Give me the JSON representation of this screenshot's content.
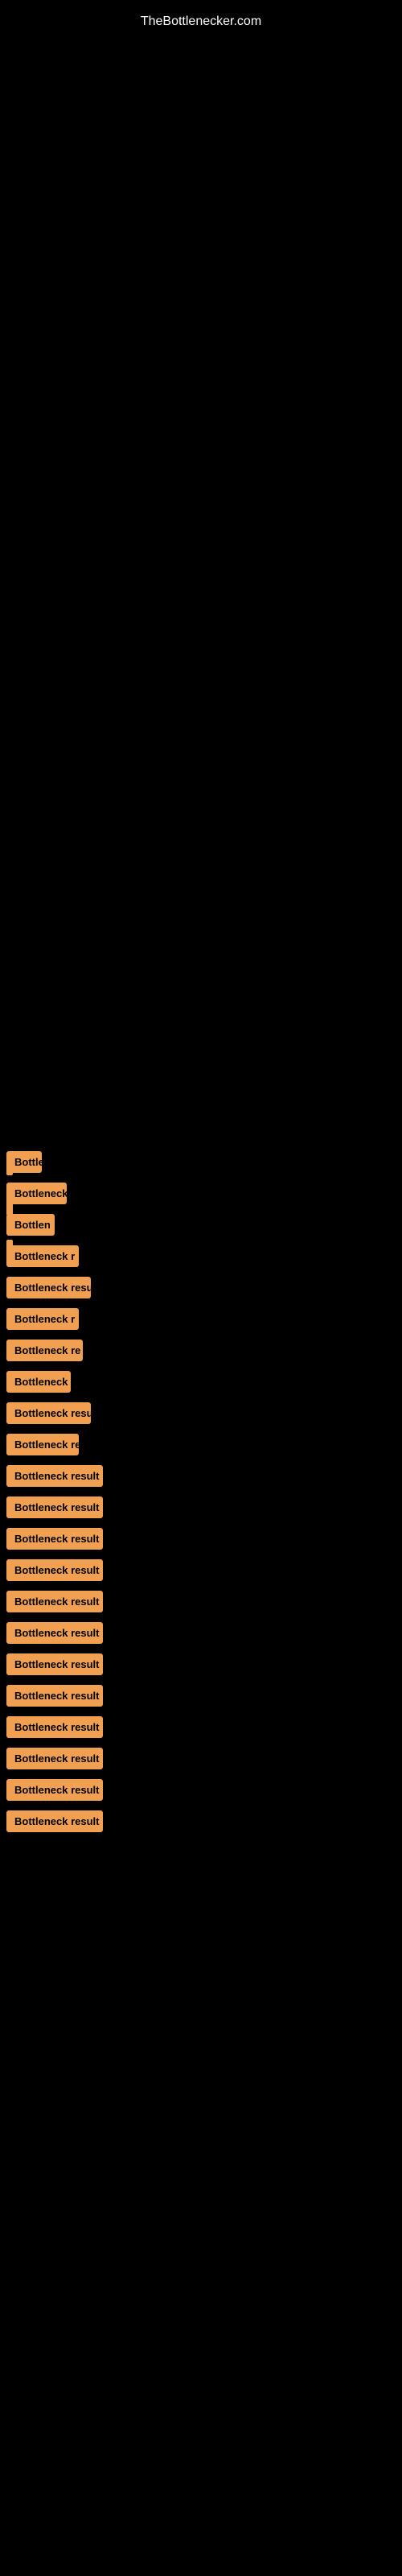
{
  "site": {
    "title": "TheBottlenecker.com"
  },
  "indicators": [
    {
      "id": "ind-1"
    },
    {
      "id": "ind-2"
    },
    {
      "id": "ind-3"
    }
  ],
  "items": [
    {
      "id": 1,
      "label": "Bottle",
      "class": "item-1"
    },
    {
      "id": 2,
      "label": "Bottleneck",
      "class": "item-2"
    },
    {
      "id": 3,
      "label": "Bottlen",
      "class": "item-3"
    },
    {
      "id": 4,
      "label": "Bottleneck r",
      "class": "item-4"
    },
    {
      "id": 5,
      "label": "Bottleneck resu",
      "class": "item-5"
    },
    {
      "id": 6,
      "label": "Bottleneck r",
      "class": "item-6"
    },
    {
      "id": 7,
      "label": "Bottleneck re",
      "class": "item-7"
    },
    {
      "id": 8,
      "label": "Bottleneck",
      "class": "item-8"
    },
    {
      "id": 9,
      "label": "Bottleneck resu",
      "class": "item-9"
    },
    {
      "id": 10,
      "label": "Bottleneck re",
      "class": "item-10"
    },
    {
      "id": 11,
      "label": "Bottleneck result",
      "class": "item-11"
    },
    {
      "id": 12,
      "label": "Bottleneck result",
      "class": "item-12"
    },
    {
      "id": 13,
      "label": "Bottleneck result",
      "class": "item-13"
    },
    {
      "id": 14,
      "label": "Bottleneck result",
      "class": "item-14"
    },
    {
      "id": 15,
      "label": "Bottleneck result",
      "class": "item-15"
    },
    {
      "id": 16,
      "label": "Bottleneck result",
      "class": "item-16"
    },
    {
      "id": 17,
      "label": "Bottleneck result",
      "class": "item-17"
    },
    {
      "id": 18,
      "label": "Bottleneck result",
      "class": "item-18"
    },
    {
      "id": 19,
      "label": "Bottleneck result",
      "class": "item-19"
    },
    {
      "id": 20,
      "label": "Bottleneck result",
      "class": "item-20"
    },
    {
      "id": 21,
      "label": "Bottleneck result",
      "class": "item-21"
    },
    {
      "id": 22,
      "label": "Bottleneck result",
      "class": "item-22"
    }
  ]
}
